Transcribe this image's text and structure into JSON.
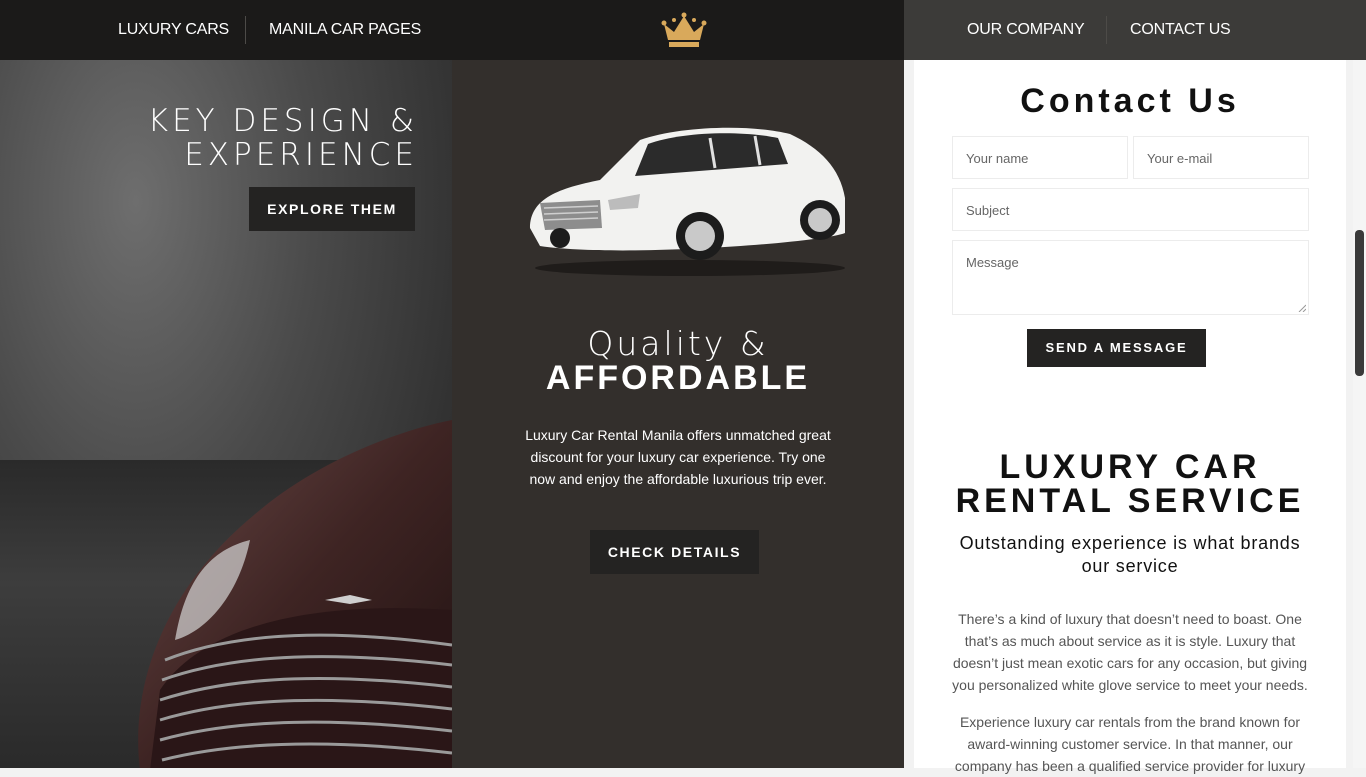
{
  "nav": {
    "left_links": [
      "LUXURY CARS",
      "MANILA CAR PAGES"
    ],
    "right_links": [
      "OUR COMPANY",
      "CONTACT US"
    ],
    "logo_icon": "crown-icon",
    "logo_color": "#d9a95b"
  },
  "left_panel": {
    "title_line1": "KEY DESIGN &",
    "title_line2": "EXPERIENCE",
    "button_label": "EXPLORE THEM"
  },
  "middle_panel": {
    "title_light": "Quality &",
    "title_bold": "AFFORDABLE",
    "description": "Luxury Car Rental Manila offers unmatched great discount for your luxury car experience. Try one now and enjoy the affordable luxurious trip ever.",
    "button_label": "CHECK DETAILS"
  },
  "contact_form": {
    "title": "Contact Us",
    "name_placeholder": "Your name",
    "email_placeholder": "Your e-mail",
    "subject_placeholder": "Subject",
    "message_placeholder": "Message",
    "submit_label": "SEND A MESSAGE"
  },
  "service": {
    "title_line1": "LUXURY CAR",
    "title_line2": "RENTAL SERVICE",
    "subtitle": "Outstanding experience is what brands our service",
    "paragraph1": "There’s a kind of luxury that doesn’t need to boast. One that’s as much about service as it is style. Luxury that doesn’t just mean exotic cars for any occasion, but giving you personalized white glove service to meet your needs.",
    "paragraph2": "Experience luxury car rentals from the brand known for award-winning customer service. In that manner, our company has been a qualified service provider for luxury"
  },
  "colors": {
    "nav_left_bg": "#1b1a19",
    "nav_right_bg": "#3c3b39",
    "middle_bg": "#332f2c",
    "button_bg": "#242322"
  }
}
